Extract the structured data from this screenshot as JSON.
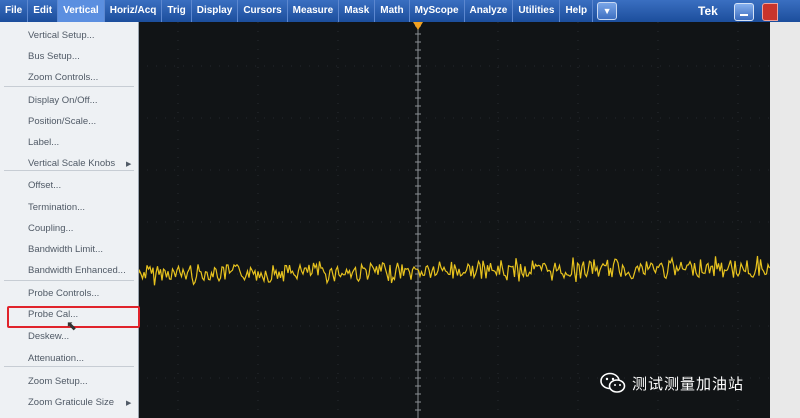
{
  "menubar": {
    "items": [
      "File",
      "Edit",
      "Vertical",
      "Horiz/Acq",
      "Trig",
      "Display",
      "Cursors",
      "Measure",
      "Mask",
      "Math",
      "MyScope",
      "Analyze",
      "Utilities",
      "Help"
    ],
    "active_index": 2,
    "dropdown_icon": "chevron-down-icon",
    "brand": "Tek"
  },
  "vertical_menu": {
    "groups": [
      [
        "Vertical Setup...",
        "Bus Setup...",
        "Zoom Controls..."
      ],
      [
        "Display On/Off...",
        "Position/Scale...",
        "Label...",
        "Vertical Scale Knobs"
      ],
      [
        "Offset...",
        "Termination...",
        "Coupling...",
        "Bandwidth Limit...",
        "Bandwidth Enhanced..."
      ],
      [
        "Probe Controls...",
        "Probe Cal...",
        "Deskew...",
        "Attenuation..."
      ],
      [
        "Zoom Setup...",
        "Zoom Graticule Size"
      ]
    ],
    "submenu_items": [
      "Vertical Scale Knobs",
      "Zoom Graticule Size"
    ],
    "highlighted_item": "Probe Cal..."
  },
  "waveform": {
    "channel_color": "#e8c31e",
    "trigger_marker_color": "#f0a020"
  },
  "watermark": {
    "text": "测试测量加油站",
    "icon": "wechat-icon"
  },
  "colors": {
    "menubar_bg": "#2a5fb0",
    "highlight_border": "#e0232b",
    "graticule": "#8a8f94"
  }
}
